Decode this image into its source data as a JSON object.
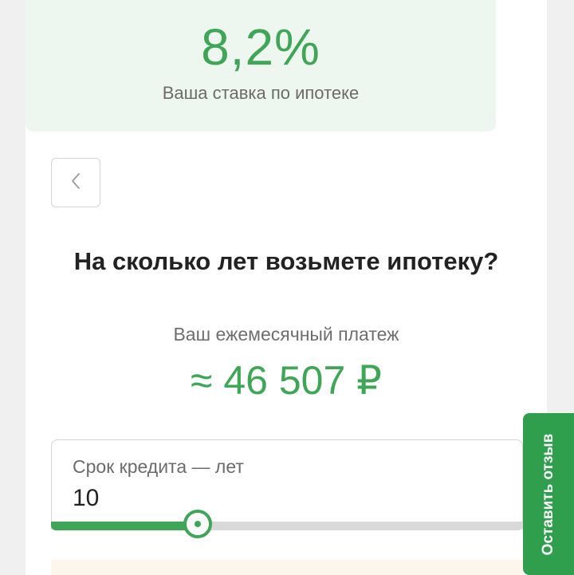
{
  "rate": {
    "value": "8,2%",
    "label": "Ваша ставка по ипотеке"
  },
  "back_button": {
    "icon": "chevron-left-icon"
  },
  "question": "На сколько лет возьмете ипотеку?",
  "payment": {
    "label": "Ваш ежемесячный платеж",
    "value": "≈ 46 507 ₽"
  },
  "term": {
    "label": "Срок кредита — лет",
    "value": "10",
    "slider_fraction": 0.31
  },
  "feedback": {
    "label": "Оставить отзыв"
  },
  "colors": {
    "accent": "#3fa657",
    "feedback_bg": "#2f9e4d",
    "rate_box_bg": "#eef7ef"
  }
}
